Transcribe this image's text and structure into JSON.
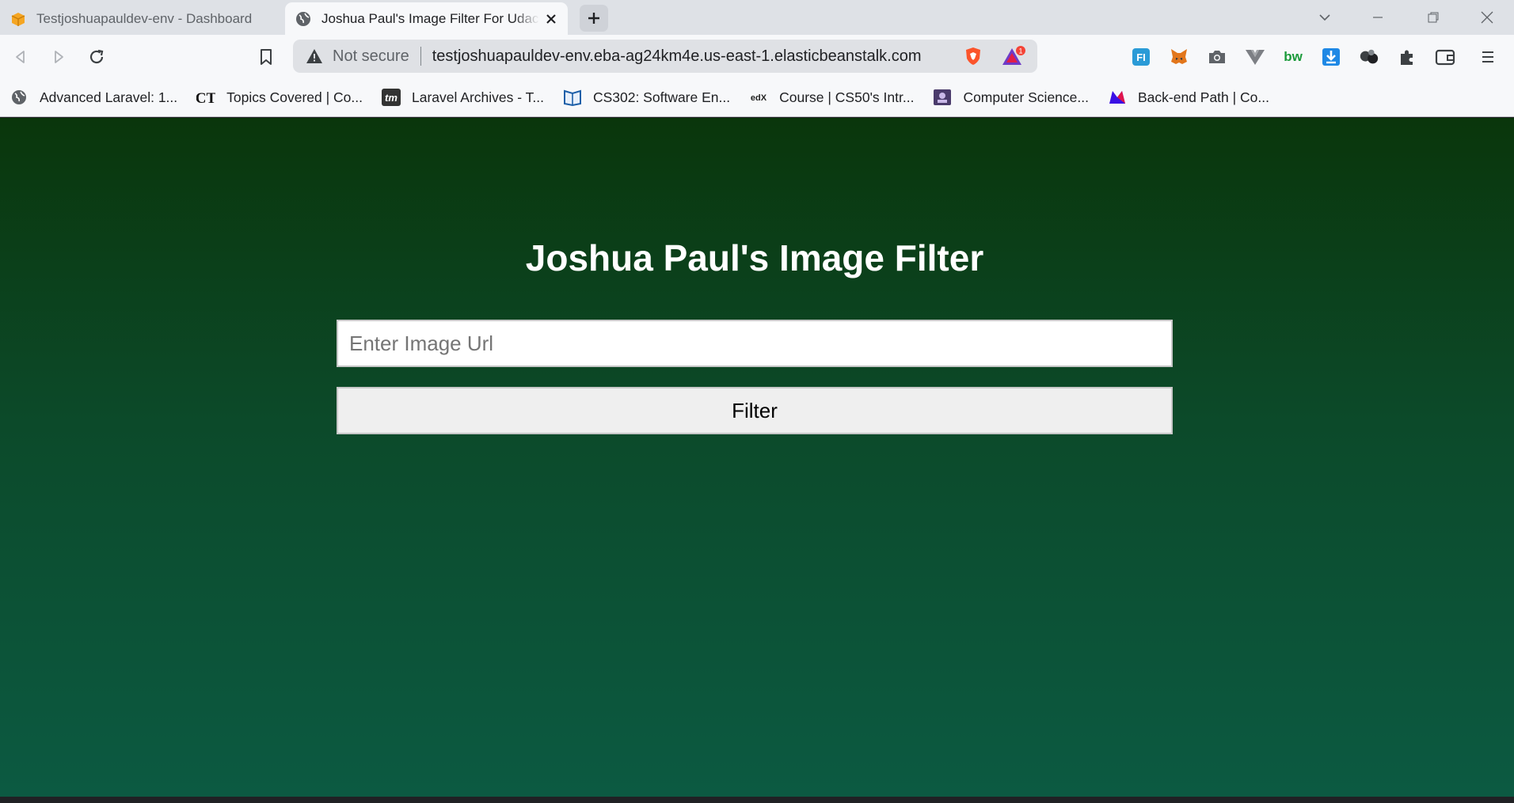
{
  "tabs": [
    {
      "title": "Testjoshuapauldev-env - Dashboard",
      "active": false,
      "icon": "aws-box-icon"
    },
    {
      "title": "Joshua Paul's Image Filter For Udacity",
      "active": true,
      "icon": "globe-icon"
    }
  ],
  "toolbar": {
    "security_label": "Not secure",
    "url": "testjoshuapauldev-env.eba-ag24km4e.us-east-1.elasticbeanstalk.com",
    "rewards_badge": "1"
  },
  "extensions": [
    {
      "name": "fi-extension-icon",
      "label": "FI"
    },
    {
      "name": "metamask-fox-icon",
      "label": ""
    },
    {
      "name": "camera-icon",
      "label": ""
    },
    {
      "name": "vue-devtools-icon",
      "label": ""
    },
    {
      "name": "bw-extension-icon",
      "label": "bw"
    },
    {
      "name": "download-icon",
      "label": ""
    },
    {
      "name": "balls-extension-icon",
      "label": ""
    },
    {
      "name": "puzzle-extensions-icon",
      "label": ""
    },
    {
      "name": "wallet-icon",
      "label": ""
    },
    {
      "name": "menu-icon",
      "label": ""
    }
  ],
  "bookmarks": [
    {
      "label": "Advanced Laravel: 1...",
      "icon": "globe-icon"
    },
    {
      "label": "Topics Covered | Co...",
      "icon": "ct-logo-icon"
    },
    {
      "label": "Laravel Archives - T...",
      "icon": "tm-logo-icon"
    },
    {
      "label": "CS302: Software En...",
      "icon": "saylor-logo-icon"
    },
    {
      "label": "Course | CS50's Intr...",
      "icon": "edx-logo-icon"
    },
    {
      "label": "Computer Science...",
      "icon": "ossu-logo-icon"
    },
    {
      "label": "Back-end Path | Co...",
      "icon": "codecademy-logo-icon"
    }
  ],
  "bookmark_badges": {
    "ct": "CT",
    "tm": "tm",
    "edx": "edX"
  },
  "page": {
    "title": "Joshua Paul's Image Filter",
    "input_placeholder": "Enter Image Url",
    "button_label": "Filter"
  },
  "colors": {
    "page_top": "#0a360b",
    "page_bottom": "#0c5a42",
    "brave_orange": "#fb542b",
    "rewards_badge": "#f44336"
  }
}
